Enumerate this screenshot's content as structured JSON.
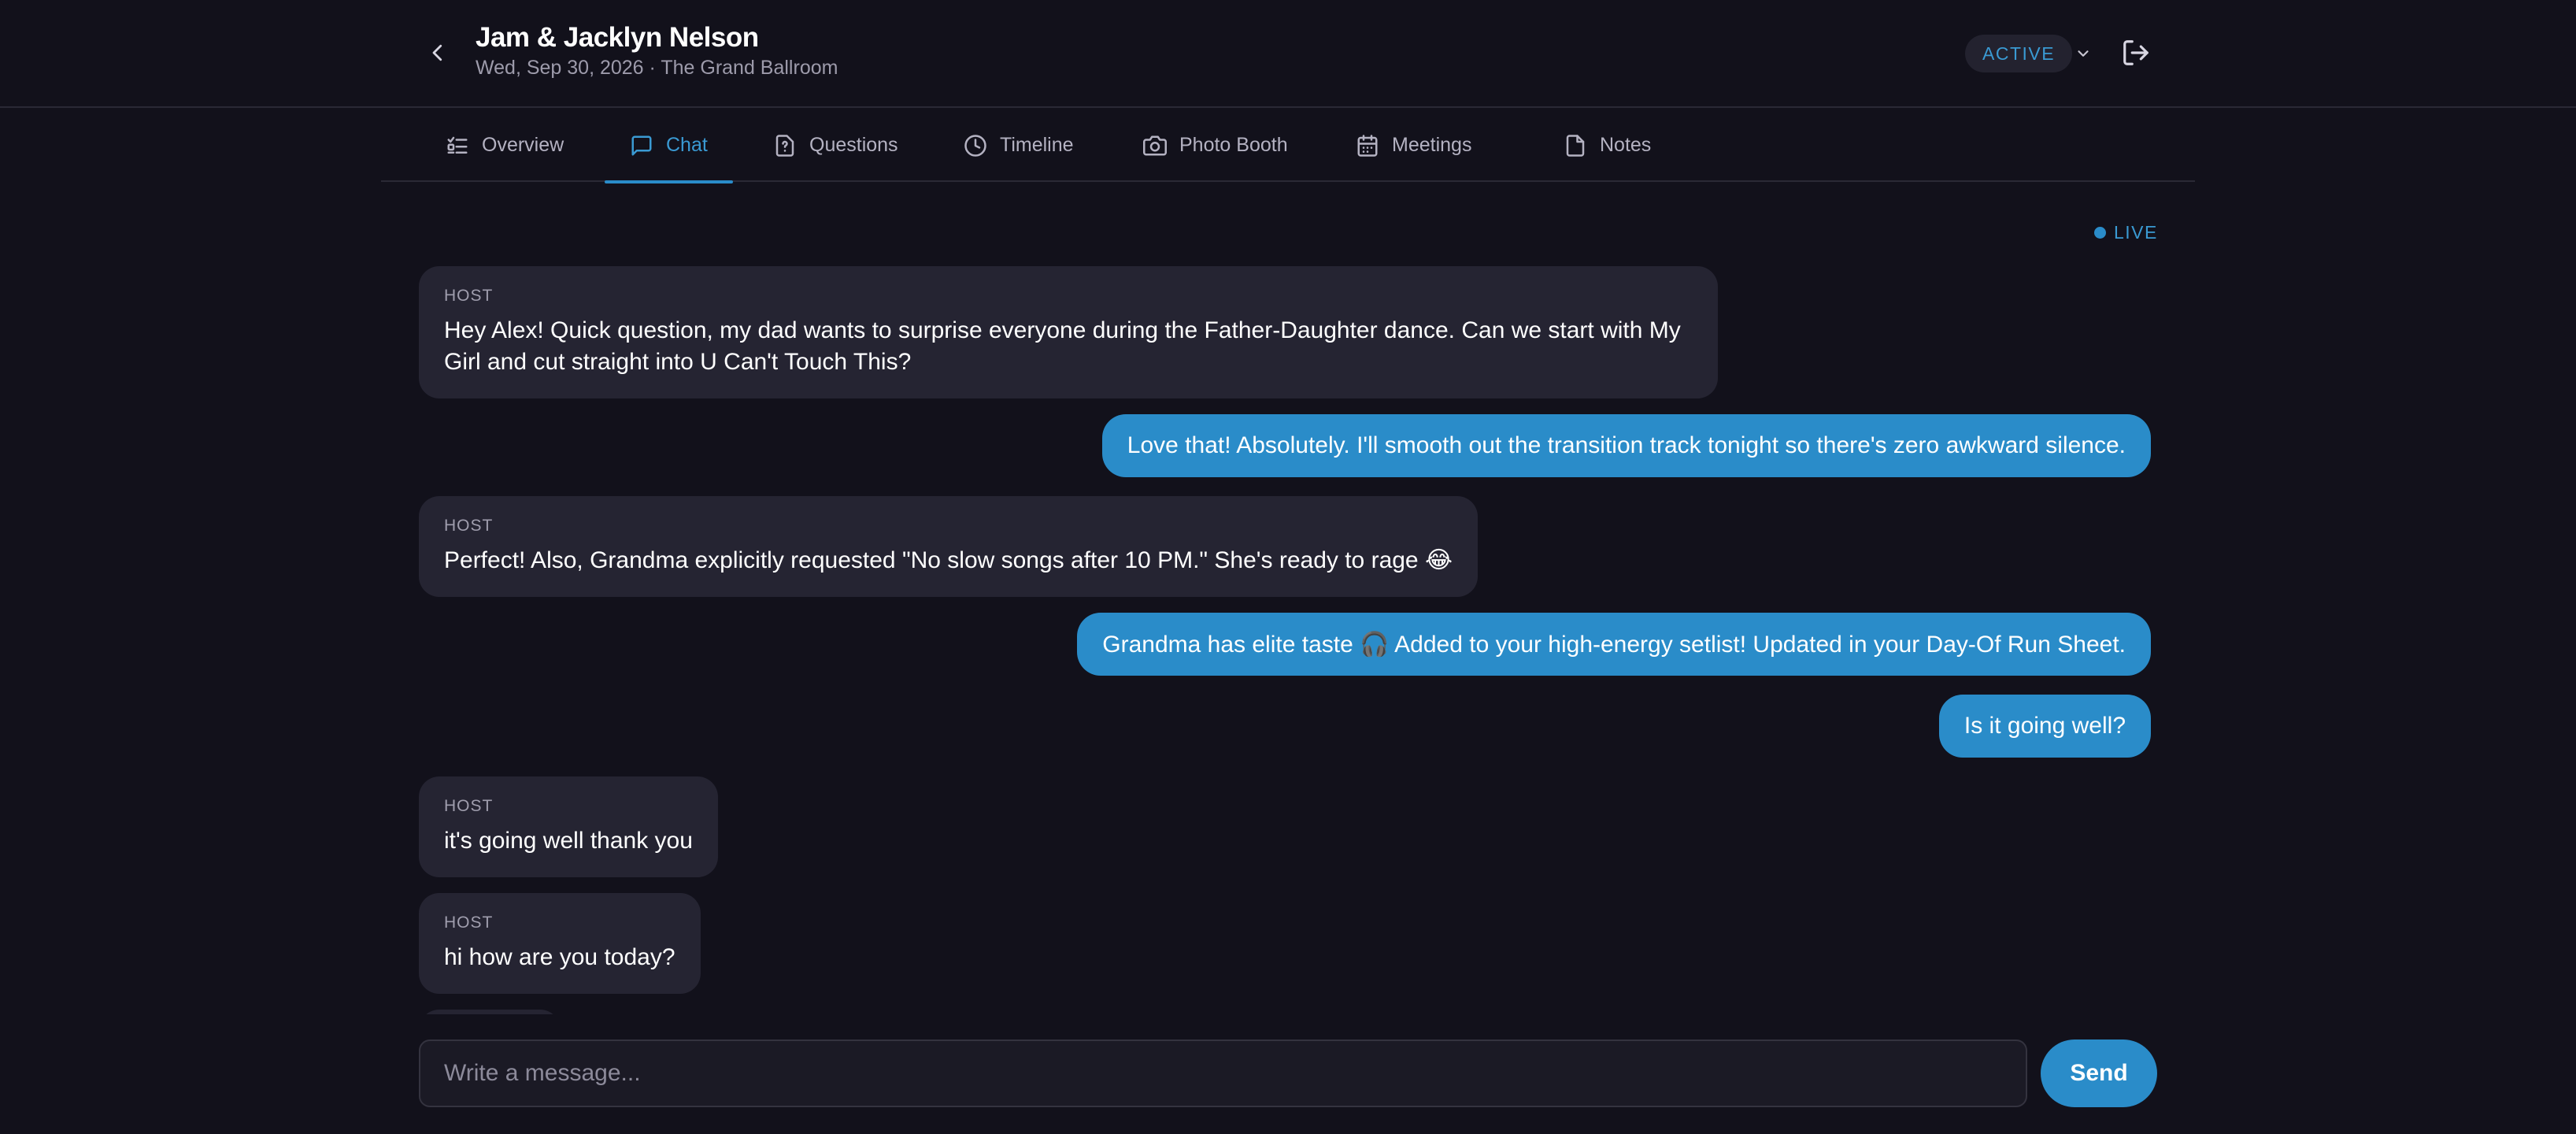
{
  "header": {
    "title": "Jam & Jacklyn Nelson",
    "subtitle": "Wed, Sep 30, 2026 · The Grand Ballroom",
    "status": "ACTIVE"
  },
  "tabs": [
    {
      "label": "Overview",
      "icon": "list-check-icon",
      "active": false
    },
    {
      "label": "Chat",
      "icon": "chat-bubble-icon",
      "active": true
    },
    {
      "label": "Questions",
      "icon": "question-file-icon",
      "active": false
    },
    {
      "label": "Timeline",
      "icon": "clock-icon",
      "active": false
    },
    {
      "label": "Photo Booth",
      "icon": "camera-icon",
      "active": false
    },
    {
      "label": "Meetings",
      "icon": "calendar-icon",
      "active": false
    },
    {
      "label": "Notes",
      "icon": "note-icon",
      "active": false
    }
  ],
  "live_label": "LIVE",
  "messages": [
    {
      "sender": "host",
      "label": "HOST",
      "text": "Hey Alex! Quick question, my dad wants to surprise everyone during the Father-Daughter dance. Can we start with My Girl and cut straight into U Can't Touch This?"
    },
    {
      "sender": "me",
      "text": "Love that! Absolutely. I'll smooth out the transition track tonight so there's zero awkward silence."
    },
    {
      "sender": "host",
      "label": "HOST",
      "text": "Perfect! Also, Grandma explicitly requested \"No slow songs after 10 PM.\" She's ready to rage 😂"
    },
    {
      "sender": "me",
      "text": "Grandma has elite taste 🎧 Added to your high-energy setlist! Updated in your Day-Of Run Sheet."
    },
    {
      "sender": "me",
      "text": "Is it going well?"
    },
    {
      "sender": "host",
      "label": "HOST",
      "text": "it's going well thank you"
    },
    {
      "sender": "host",
      "label": "HOST",
      "text": "hi how are you today?"
    }
  ],
  "composer": {
    "placeholder": "Write a message...",
    "value": "",
    "send_label": "Send"
  },
  "colors": {
    "accent": "#2a8cc9",
    "background": "#12111b",
    "host_bubble": "#252432"
  }
}
